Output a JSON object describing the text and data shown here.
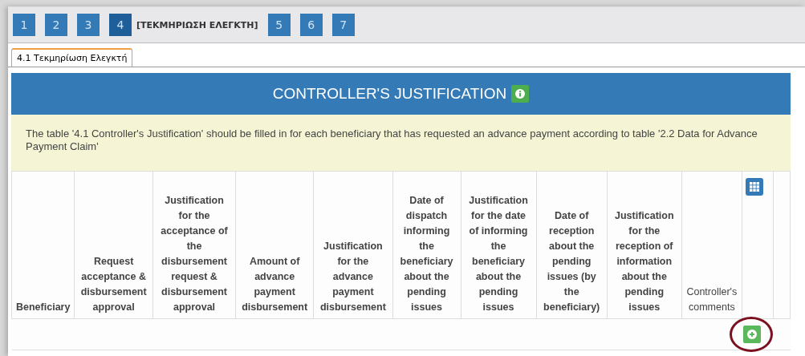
{
  "steps": [
    {
      "number": "1",
      "selected": false
    },
    {
      "number": "2",
      "selected": false
    },
    {
      "number": "3",
      "selected": false
    },
    {
      "number": "4",
      "label": "[ΤΕΚΜΗΡΙΩΣΗ ΕΛΕΓΚΤΗ]",
      "selected": true
    },
    {
      "number": "5",
      "selected": false
    },
    {
      "number": "6",
      "selected": false
    },
    {
      "number": "7",
      "selected": false
    }
  ],
  "tabs": [
    {
      "label": "4.1 Τεκμηρίωση Ελεγκτή",
      "selected": true
    }
  ],
  "panel": {
    "title": "CONTROLLER'S JUSTIFICATION",
    "note": "The table '4.1 Controller's Justification' should be filled in for each beneficiary that has requested an advance payment according to table '2.2 Data for Advance Payment Claim'"
  },
  "table": {
    "columns": [
      {
        "label": "Beneficiary"
      },
      {
        "label": "Request acceptance & disbursement approval"
      },
      {
        "label": "Justification for the acceptance of the disbursement request & disbursement approval"
      },
      {
        "label": "Amount of advance payment disbursement"
      },
      {
        "label": "Justification for the advance payment disbursement"
      },
      {
        "label": "Date of dispatch informing the beneficiary about the pending issues"
      },
      {
        "label": "Justification for the date of informing the beneficiary about the pending issues"
      },
      {
        "label": "Date of reception about the pending issues (by the beneficiary)"
      },
      {
        "label": "Justification for the reception of information about the pending issues"
      },
      {
        "label": "Controller's comments",
        "bold": false
      }
    ],
    "add_highlighted": true
  }
}
